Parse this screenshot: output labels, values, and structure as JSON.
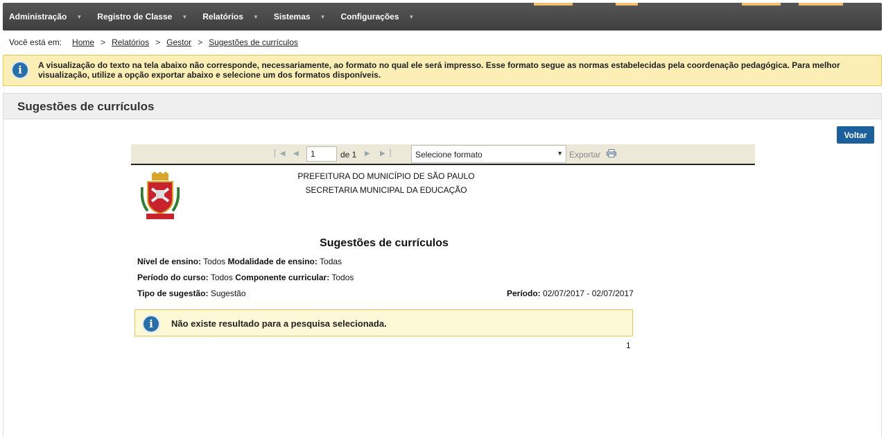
{
  "nav": {
    "items": [
      {
        "label": "Administração"
      },
      {
        "label": "Registro de Classe"
      },
      {
        "label": "Relatórios"
      },
      {
        "label": "Sistemas"
      },
      {
        "label": "Configurações"
      }
    ],
    "caret": "▼"
  },
  "breadcrumb": {
    "prefix": "Você está em:",
    "items": [
      "Home",
      "Relatórios",
      "Gestor",
      "Sugestões de currículos"
    ],
    "separator": ">"
  },
  "alert": {
    "text": "A visualização do texto na tela abaixo não corresponde, necessariamente, ao formato no qual ele será impresso. Esse formato segue as normas estabelecidas pela coordenação pedagógica. Para melhor visualização, utilize a opção exportar abaixo e selecione um dos formatos disponíveis.",
    "icon": "info-icon"
  },
  "panel": {
    "title": "Sugestões de currículos",
    "back_button": "Voltar"
  },
  "viewer": {
    "current_page": "1",
    "page_of": "de 1",
    "format_placeholder": "Selecione formato",
    "export_label": "Exportar"
  },
  "report": {
    "header_line1": "PREFEITURA DO MUNICÍPIO DE SÃO PAULO",
    "header_line2": "SECRETARIA MUNICIPAL DA EDUCAÇÃO",
    "title": "Sugestões de currículos",
    "filters": {
      "nivel_label": "Nível de ensino:",
      "nivel_value": "Todos",
      "modalidade_label": "Modalidade de ensino:",
      "modalidade_value": "Todas",
      "periodo_curso_label": "Período do curso:",
      "periodo_curso_value": "Todos",
      "componente_label": "Componente curricular:",
      "componente_value": "Todos",
      "tipo_label": "Tipo de sugestão:",
      "tipo_value": "Sugestão",
      "periodo_label": "Período:",
      "periodo_value": "02/07/2017 - 02/07/2017"
    },
    "no_result": "Não existe resultado para a pesquisa selecionada.",
    "page_number": "1"
  },
  "colors": {
    "nav_bg": "#474747",
    "alert_bg": "#fcefb5",
    "button_bg": "#1c5f9d",
    "info_icon": "#2a6ea8"
  }
}
